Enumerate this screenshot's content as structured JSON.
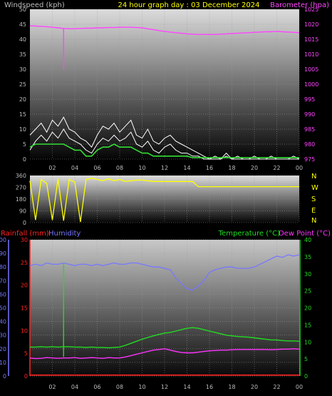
{
  "colors": {
    "wind": "#ffffff",
    "gust": "#ffffff",
    "wind_avg": "#33dd33",
    "barometer": "#ff44ff",
    "direction": "#ffff00",
    "rainfall": "#ff2222",
    "humidity": "#7777ff",
    "temperature": "#22dd22",
    "dewpoint": "#ff33ff",
    "axis_text": "#bbbbbb",
    "title_text": "#ffff00"
  },
  "chart_data": [
    {
      "type": "line",
      "title": "24 hour graph day : 03 December 2024",
      "left_axis_label": "Windspeed (kph)",
      "right_axis_label": "Barometer (hpa)",
      "x_ticks": [
        "02",
        "04",
        "06",
        "08",
        "10",
        "12",
        "14",
        "16",
        "18",
        "20",
        "22",
        "00"
      ],
      "ylim_left": [
        0,
        50
      ],
      "ylim_right": [
        975,
        1025
      ],
      "left_ticks": [
        "0",
        "5",
        "10",
        "15",
        "20",
        "25",
        "30",
        "35",
        "40",
        "45",
        "50"
      ],
      "right_ticks": [
        "975",
        "980",
        "985",
        "990",
        "995",
        "1000",
        "1005",
        "1010",
        "1015",
        "1020",
        "1025"
      ],
      "grid": true,
      "hours": [
        0,
        0.5,
        1,
        1.5,
        2,
        2.5,
        3,
        3.5,
        4,
        4.5,
        5,
        5.5,
        6,
        6.5,
        7,
        7.5,
        8,
        8.5,
        9,
        9.5,
        10,
        10.5,
        11,
        11.5,
        12,
        12.5,
        13,
        13.5,
        14,
        14.5,
        15,
        15.5,
        16,
        16.5,
        17,
        17.5,
        18,
        18.5,
        19,
        19.5,
        20,
        20.5,
        21,
        21.5,
        22,
        22.5,
        23,
        23.5,
        24
      ],
      "series": [
        {
          "role": "gust",
          "axis": "left",
          "values": [
            8,
            10,
            12,
            9,
            13,
            11,
            14,
            10,
            9,
            7,
            6,
            4,
            8,
            11,
            10,
            12,
            9,
            11,
            13,
            8,
            7,
            10,
            6,
            5,
            7,
            8,
            6,
            5,
            4,
            3,
            2,
            1,
            0,
            1,
            0,
            2,
            0,
            1,
            0,
            0,
            1,
            0,
            0,
            1,
            0,
            0,
            0,
            1,
            0
          ]
        },
        {
          "role": "wind",
          "axis": "left",
          "values": [
            3,
            6,
            8,
            6,
            9,
            7,
            10,
            7,
            6,
            5,
            3,
            2,
            5,
            7,
            6,
            8,
            6,
            7,
            9,
            5,
            4,
            6,
            3,
            2,
            4,
            5,
            3,
            2,
            2,
            1,
            1,
            0,
            0,
            0,
            0,
            1,
            0,
            0,
            0,
            0,
            0,
            0,
            0,
            0,
            0,
            0,
            0,
            0,
            0
          ]
        },
        {
          "role": "wind-average",
          "axis": "left",
          "values": [
            4,
            5,
            5,
            5,
            5,
            5,
            5,
            4,
            3,
            3,
            1,
            1,
            3,
            4,
            4,
            5,
            4,
            4,
            4,
            3,
            2,
            2,
            1,
            1,
            1,
            1,
            1,
            1,
            1,
            0.5,
            0.5,
            0.5,
            0.5,
            0.5,
            0.5,
            0.5,
            0.5,
            0.5,
            0.5,
            0.5,
            0.5,
            0.5,
            0.5,
            0.5,
            0.5,
            0.5,
            0.5,
            0.5,
            0.5
          ]
        },
        {
          "role": "barometer",
          "axis": "right",
          "values": [
            1019.5,
            1019.4,
            1019.3,
            1019.2,
            1019,
            1018.8,
            1018.6,
            1018.5,
            1018.5,
            1018.6,
            1018.7,
            1018.7,
            1018.8,
            1018.8,
            1018.9,
            1018.9,
            1019,
            1019,
            1019,
            1018.9,
            1018.8,
            1018.5,
            1018.2,
            1017.9,
            1017.6,
            1017.4,
            1017.2,
            1017,
            1016.8,
            1016.7,
            1016.6,
            1016.6,
            1016.6,
            1016.6,
            1016.7,
            1016.8,
            1016.9,
            1017,
            1017.1,
            1017.2,
            1017.3,
            1017.4,
            1017.5,
            1017.5,
            1017.6,
            1017.5,
            1017.4,
            1017.3,
            1017.2
          ]
        }
      ],
      "barometer_spike": {
        "hour": 3,
        "value": 1005
      }
    },
    {
      "type": "line",
      "left_ticks": [
        "0",
        "90",
        "180",
        "270",
        "360"
      ],
      "ylim": [
        0,
        360
      ],
      "right_labels": [
        "N",
        "W",
        "S",
        "E",
        "N"
      ],
      "grid": true,
      "hours": [
        0,
        0.5,
        1,
        1.5,
        2,
        2.5,
        3,
        3.5,
        4,
        4.5,
        5,
        5.5,
        6,
        6.5,
        7,
        7.5,
        8,
        8.5,
        9,
        9.5,
        10,
        10.5,
        11,
        11.5,
        12,
        12.5,
        13,
        13.5,
        14,
        14.5,
        15,
        15.5,
        16,
        16.5,
        17,
        17.5,
        18,
        18.5,
        19,
        19.5,
        20,
        20.5,
        21,
        21.5,
        22,
        22.5,
        23,
        23.5,
        24
      ],
      "series": [
        {
          "role": "direction",
          "values": [
            320,
            20,
            330,
            300,
            20,
            335,
            15,
            330,
            310,
            5,
            330,
            340,
            330,
            320,
            335,
            320,
            330,
            315,
            320,
            325,
            325,
            320,
            315,
            315,
            315,
            315,
            315,
            315,
            315,
            315,
            275,
            275,
            275,
            275,
            275,
            275,
            275,
            275,
            275,
            275,
            275,
            275,
            275,
            275,
            275,
            275,
            275,
            275,
            275
          ]
        }
      ]
    },
    {
      "type": "line",
      "left_label_1": "Rainfall (mm)",
      "left_label_2": "Humidity",
      "right_label_1": "Temperature (°C)",
      "right_label_2": "Dew Point (°C)",
      "x_ticks": [
        "02",
        "04",
        "06",
        "08",
        "10",
        "12",
        "14",
        "16",
        "18",
        "20",
        "22",
        "00"
      ],
      "humidity_ticks": [
        "0",
        "10",
        "20",
        "30",
        "40",
        "50",
        "60",
        "70",
        "80",
        "90",
        "100"
      ],
      "rain_ticks": [
        "0",
        "5",
        "10",
        "15",
        "20",
        "25",
        "30"
      ],
      "temp_ticks": [
        "0",
        "5",
        "10",
        "15",
        "20",
        "25",
        "30",
        "35",
        "40"
      ],
      "ylim_humidity": [
        0,
        100
      ],
      "ylim_rain": [
        0,
        30
      ],
      "ylim_temp": [
        0,
        40
      ],
      "grid": true,
      "hours": [
        0,
        0.5,
        1,
        1.5,
        2,
        2.5,
        3,
        3.5,
        4,
        4.5,
        5,
        5.5,
        6,
        6.5,
        7,
        7.5,
        8,
        8.5,
        9,
        9.5,
        10,
        10.5,
        11,
        11.5,
        12,
        12.5,
        13,
        13.5,
        14,
        14.5,
        15,
        15.5,
        16,
        16.5,
        17,
        17.5,
        18,
        18.5,
        19,
        19.5,
        20,
        20.5,
        21,
        21.5,
        22,
        22.5,
        23,
        23.5,
        24
      ],
      "series": [
        {
          "role": "humidity",
          "axis": "humidity",
          "values": [
            81,
            82,
            81,
            83,
            82,
            82,
            83,
            82,
            81,
            82,
            82,
            81,
            82,
            81,
            82,
            83,
            82,
            82,
            83,
            83,
            82,
            81,
            80,
            80,
            79,
            78,
            72,
            68,
            64,
            63,
            66,
            70,
            76,
            78,
            79,
            80,
            80,
            79,
            79,
            79,
            80,
            82,
            84,
            86,
            88,
            87,
            89,
            88,
            89
          ]
        },
        {
          "role": "temperature",
          "axis": "temp",
          "values": [
            8.5,
            8.5,
            8.6,
            8.5,
            8.6,
            8.5,
            8.6,
            8.6,
            8.5,
            8.5,
            8.4,
            8.5,
            8.4,
            8.4,
            8.3,
            8.4,
            8.5,
            9,
            9.6,
            10.2,
            10.8,
            11.3,
            11.8,
            12.2,
            12.6,
            12.8,
            13.2,
            13.6,
            14,
            14.2,
            14,
            13.6,
            13.2,
            12.8,
            12.4,
            12,
            11.8,
            11.6,
            11.5,
            11.4,
            11.2,
            11,
            10.8,
            10.6,
            10.6,
            10.4,
            10.3,
            10.3,
            10.2
          ]
        },
        {
          "role": "dew point",
          "axis": "temp",
          "values": [
            5.3,
            5.1,
            5.2,
            5.4,
            5.3,
            5.2,
            5.3,
            5.3,
            5.4,
            5.2,
            5.3,
            5.4,
            5.3,
            5.2,
            5.4,
            5.3,
            5.3,
            5.6,
            6,
            6.4,
            6.8,
            7.2,
            7.6,
            7.8,
            8,
            7.6,
            7.2,
            6.9,
            6.8,
            6.8,
            7,
            7.2,
            7.4,
            7.5,
            7.6,
            7.6,
            7.7,
            7.8,
            7.8,
            7.8,
            7.8,
            7.8,
            7.8,
            7.7,
            7.8,
            7.9,
            7.9,
            8,
            7.9
          ]
        },
        {
          "role": "rainfall",
          "axis": "rain",
          "values": [
            0.2,
            0.2,
            0.2,
            0.2,
            0.2,
            0.2,
            0.2,
            0.2,
            0.2,
            0.2,
            0.2,
            0.2,
            0.2,
            0.2,
            0.2,
            0.2,
            0.2,
            0.2,
            0.2,
            0.2,
            0.2,
            0.2,
            0.2,
            0.2,
            0.2,
            0.2,
            0.2,
            0.2,
            0.2,
            0.2,
            0.2,
            0.2,
            0.2,
            0.2,
            0.2,
            0.2,
            0.2,
            0.2,
            0.2,
            0.2,
            0.2,
            0.2,
            0.2,
            0.2,
            0.2,
            0.2,
            0.2,
            0.2,
            0.2
          ]
        }
      ],
      "humidity_spike": {
        "hour": 3,
        "from": 83,
        "to": 14
      }
    }
  ]
}
